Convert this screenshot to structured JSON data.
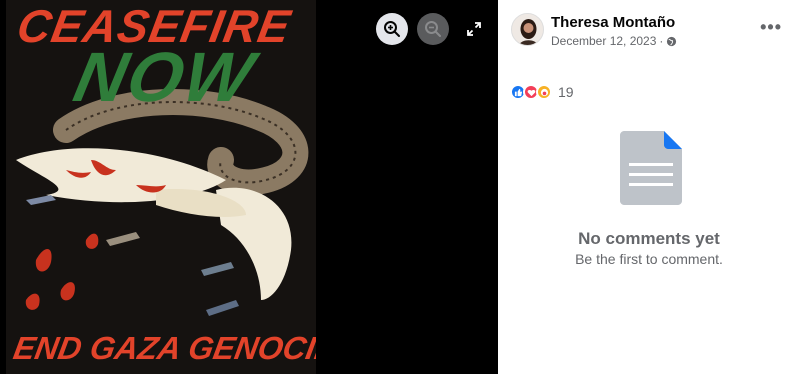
{
  "poster": {
    "title_line1": "CEASEFIRE",
    "title_line2": "NOW",
    "bottom_text": "END GAZA GENOCIDE"
  },
  "viewer": {
    "zoom_in_icon": "zoom-in-icon",
    "zoom_out_icon": "zoom-out-icon",
    "fullscreen_icon": "fullscreen-icon"
  },
  "post": {
    "author": "Theresa Montaño",
    "date": "December 12, 2023",
    "separator": "·",
    "privacy_icon": "globe-icon",
    "more_label": "•••",
    "reaction_count": "19",
    "reactions": [
      "like",
      "love",
      "care"
    ]
  },
  "comments": {
    "empty_title": "No comments yet",
    "empty_subtitle": "Be the first to comment."
  },
  "colors": {
    "accent": "#1877f2",
    "poster_red": "#e2432a",
    "poster_green": "#2f7d3a"
  }
}
